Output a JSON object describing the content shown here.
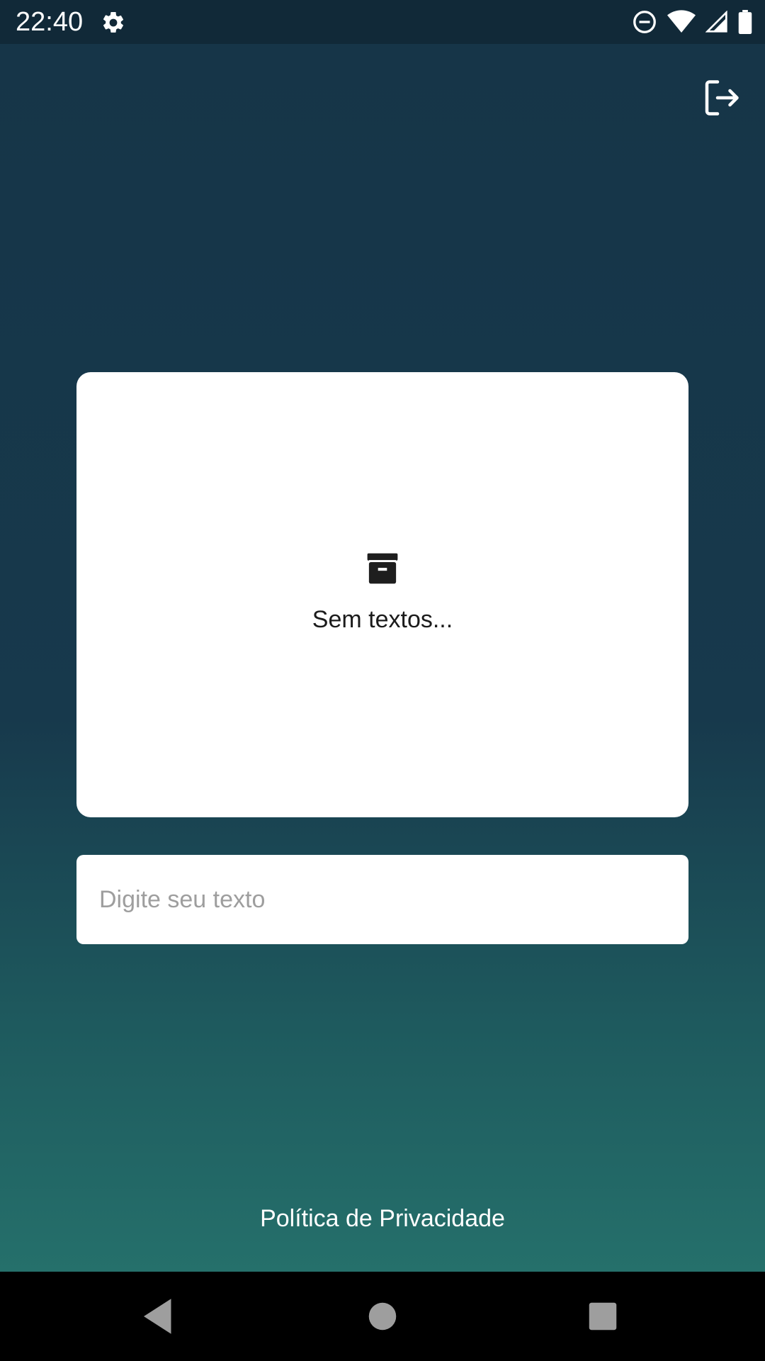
{
  "status_bar": {
    "time": "22:40",
    "icons": [
      "settings-icon",
      "do-not-disturb-icon",
      "wifi-icon",
      "signal-icon",
      "battery-icon"
    ]
  },
  "header": {
    "logout_icon": "logout-icon"
  },
  "card": {
    "empty_icon": "archive-icon",
    "empty_text": "Sem textos..."
  },
  "input": {
    "placeholder": "Digite seu texto",
    "value": ""
  },
  "footer": {
    "privacy_link": "Política de Privacidade"
  },
  "nav_bar": {
    "buttons": [
      "back",
      "home",
      "recents"
    ]
  },
  "colors": {
    "background_top": "#163548",
    "background_bottom": "#25706b",
    "card": "#ffffff",
    "status_bar": "#112938"
  }
}
